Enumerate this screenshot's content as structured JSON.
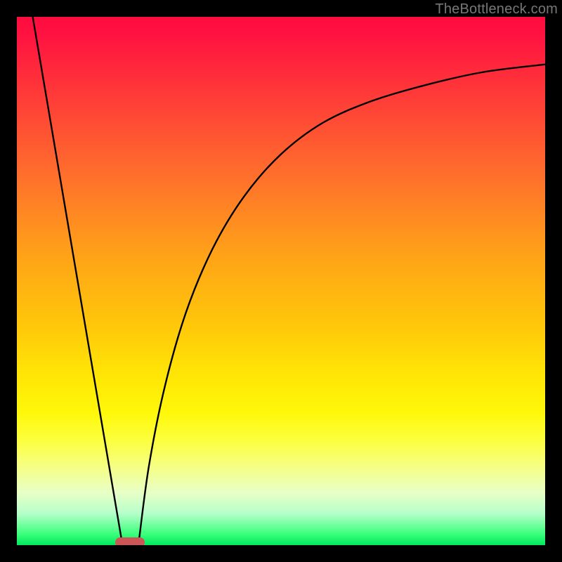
{
  "watermark": "TheBottleneck.com",
  "chart_data": {
    "type": "line",
    "title": "",
    "xlabel": "",
    "ylabel": "",
    "xlim": [
      0,
      100
    ],
    "ylim": [
      0,
      100
    ],
    "grid": false,
    "legend": false,
    "background_gradient": {
      "direction": "vertical",
      "stops": [
        {
          "pos": 0,
          "color": "#ff0b3e"
        },
        {
          "pos": 15,
          "color": "#ff3b38"
        },
        {
          "pos": 30,
          "color": "#ff6f2c"
        },
        {
          "pos": 45,
          "color": "#ffa218"
        },
        {
          "pos": 58,
          "color": "#ffc60a"
        },
        {
          "pos": 68,
          "color": "#ffe606"
        },
        {
          "pos": 80,
          "color": "#fcff3c"
        },
        {
          "pos": 90,
          "color": "#e8ffc6"
        },
        {
          "pos": 98,
          "color": "#37ff79"
        },
        {
          "pos": 100,
          "color": "#00e85d"
        }
      ]
    },
    "series": [
      {
        "name": "left-line",
        "type": "line",
        "x": [
          3,
          20
        ],
        "y": [
          100,
          0
        ]
      },
      {
        "name": "right-curve",
        "type": "line",
        "x": [
          23,
          25,
          28,
          32,
          37,
          43,
          50,
          58,
          67,
          77,
          88,
          100
        ],
        "y": [
          0,
          15,
          30,
          44,
          56,
          66,
          74,
          80,
          84,
          87,
          89.5,
          91
        ]
      }
    ],
    "marker": {
      "name": "bottleneck-marker",
      "x_center": 21.5,
      "y": 0,
      "color": "#cb5658",
      "shape": "pill"
    }
  },
  "layout": {
    "image_size": 800,
    "plot_inset": 24,
    "plot_size": 752,
    "marker_px": {
      "left": 140,
      "bottom": -3,
      "width": 42,
      "height": 14
    }
  }
}
